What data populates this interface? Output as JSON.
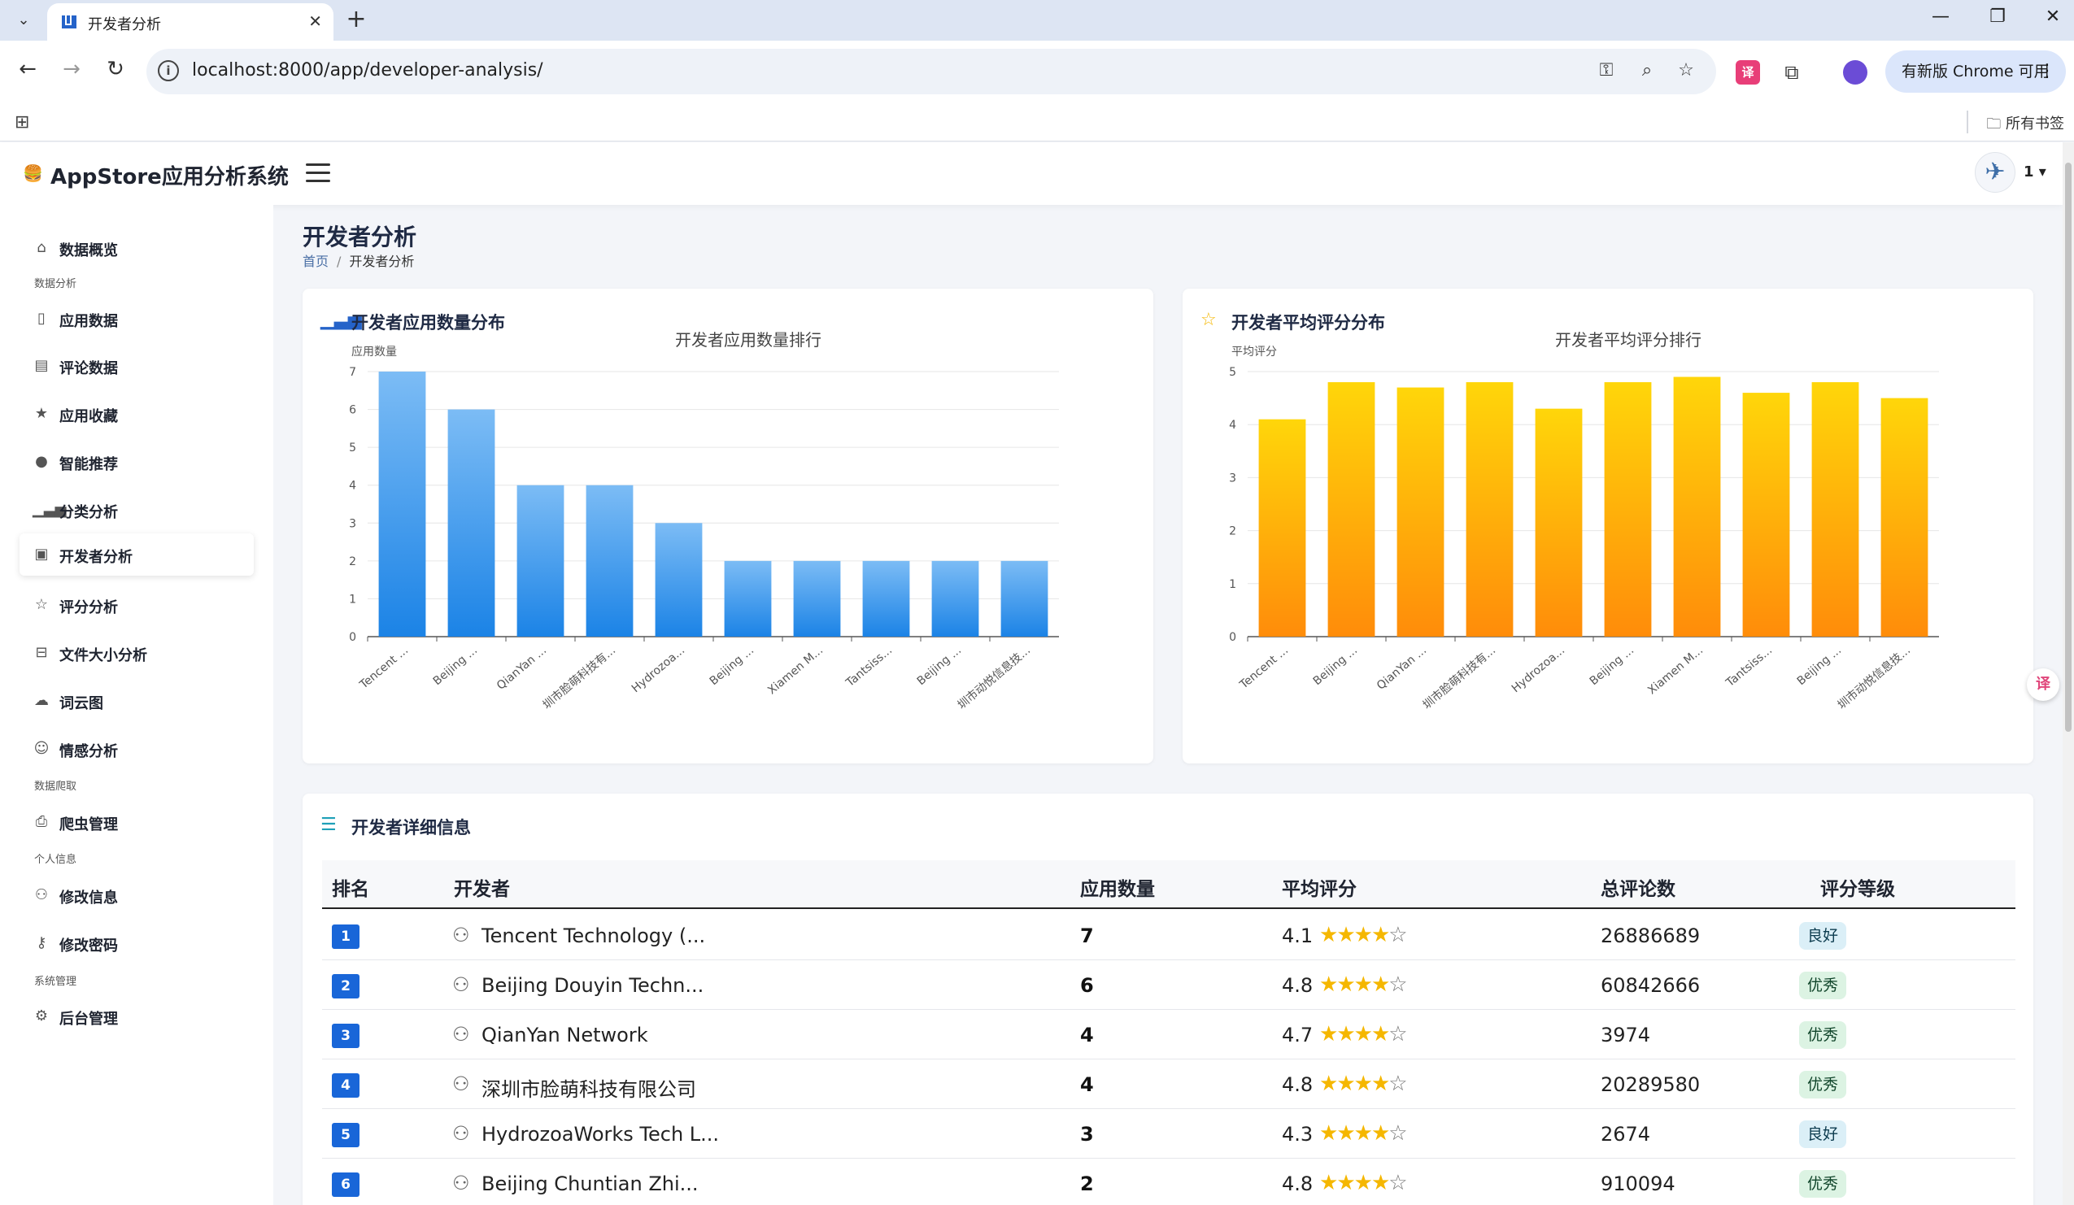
{
  "browser": {
    "tab_title": "开发者分析",
    "url": "localhost:8000/app/developer-analysis/",
    "update_label": "有新版 Chrome 可用",
    "all_bookmarks": "所有书签"
  },
  "app": {
    "title": "AppStore应用分析系统",
    "user": "1 ▾"
  },
  "sidebar": {
    "items": [
      {
        "label": "数据概览",
        "icon": "home-icon"
      },
      {
        "label": "应用数据",
        "icon": "phone-icon"
      },
      {
        "label": "评论数据",
        "icon": "comment-icon"
      },
      {
        "label": "应用收藏",
        "icon": "star-icon"
      },
      {
        "label": "智能推荐",
        "icon": "bulb-icon"
      },
      {
        "label": "分类分析",
        "icon": "bar-chart-icon"
      },
      {
        "label": "开发者分析",
        "icon": "badge-icon"
      },
      {
        "label": "评分分析",
        "icon": "star-outline-icon"
      },
      {
        "label": "文件大小分析",
        "icon": "drive-icon"
      },
      {
        "label": "词云图",
        "icon": "cloud-icon"
      },
      {
        "label": "情感分析",
        "icon": "smile-icon"
      },
      {
        "label": "爬虫管理",
        "icon": "printer-icon"
      },
      {
        "label": "修改信息",
        "icon": "user-icon"
      },
      {
        "label": "修改密码",
        "icon": "key-icon"
      },
      {
        "label": "后台管理",
        "icon": "gear-icon"
      }
    ],
    "groups": [
      "数据分析",
      "数据爬取",
      "个人信息",
      "系统管理"
    ]
  },
  "page": {
    "title": "开发者分析",
    "breadcrumb_home": "首页",
    "breadcrumb_current": "开发者分析"
  },
  "count_card": {
    "title": "开发者应用数量分布"
  },
  "rating_card": {
    "title": "开发者平均评分分布"
  },
  "chart_data": [
    {
      "type": "bar",
      "title": "开发者应用数量排行",
      "ylabel": "应用数量",
      "xlabel": "",
      "ylim": [
        0,
        7
      ],
      "yticks": [
        0,
        1,
        2,
        3,
        4,
        5,
        6,
        7
      ],
      "categories": [
        "Tencent ...",
        "Beijing ...",
        "QianYan ...",
        "圳市脸萌科技有...",
        "Hydrozoa...",
        "Beijing ...",
        "Xiamen M...",
        "Tantsiss...",
        "Beijing ...",
        "圳市动悦信息技..."
      ],
      "values": [
        7,
        6,
        4,
        4,
        3,
        2,
        2,
        2,
        2,
        2
      ],
      "grid": true,
      "color_top": "#7cbcf5",
      "color_bottom": "#1b83e6"
    },
    {
      "type": "bar",
      "title": "开发者平均评分排行",
      "ylabel": "平均评分",
      "xlabel": "",
      "ylim": [
        0,
        5
      ],
      "yticks": [
        0,
        1,
        2,
        3,
        4,
        5
      ],
      "categories": [
        "Tencent ...",
        "Beijing ...",
        "QianYan ...",
        "圳市脸萌科技有...",
        "Hydrozoa...",
        "Beijing ...",
        "Xiamen M...",
        "Tantsiss...",
        "Beijing ...",
        "圳市动悦信息技..."
      ],
      "values": [
        4.1,
        4.8,
        4.7,
        4.8,
        4.3,
        4.8,
        4.9,
        4.6,
        4.8,
        4.5
      ],
      "grid": true,
      "color_top": "#ffd60a",
      "color_bottom": "#ff8c0a"
    }
  ],
  "table": {
    "title": "开发者详细信息",
    "headers": [
      "排名",
      "开发者",
      "应用数量",
      "平均评分",
      "总评论数",
      "评分等级"
    ],
    "rows": [
      {
        "rank": "1",
        "developer": "Tencent Technology (...",
        "apps": "7",
        "rating": "4.1",
        "reviews": "26886689",
        "grade": "良好",
        "grade_type": "good"
      },
      {
        "rank": "2",
        "developer": "Beijing Douyin Techn...",
        "apps": "6",
        "rating": "4.8",
        "reviews": "60842666",
        "grade": "优秀",
        "grade_type": "excellent"
      },
      {
        "rank": "3",
        "developer": "QianYan Network",
        "apps": "4",
        "rating": "4.7",
        "reviews": "3974",
        "grade": "优秀",
        "grade_type": "excellent"
      },
      {
        "rank": "4",
        "developer": "深圳市脸萌科技有限公司",
        "apps": "4",
        "rating": "4.8",
        "reviews": "20289580",
        "grade": "优秀",
        "grade_type": "excellent"
      },
      {
        "rank": "5",
        "developer": "HydrozoaWorks Tech L...",
        "apps": "3",
        "rating": "4.3",
        "reviews": "2674",
        "grade": "良好",
        "grade_type": "good"
      },
      {
        "rank": "6",
        "developer": "Beijing Chuntian Zhi...",
        "apps": "2",
        "rating": "4.8",
        "reviews": "910094",
        "grade": "优秀",
        "grade_type": "excellent"
      }
    ],
    "stars_filled": 4,
    "stars_total": 5
  }
}
